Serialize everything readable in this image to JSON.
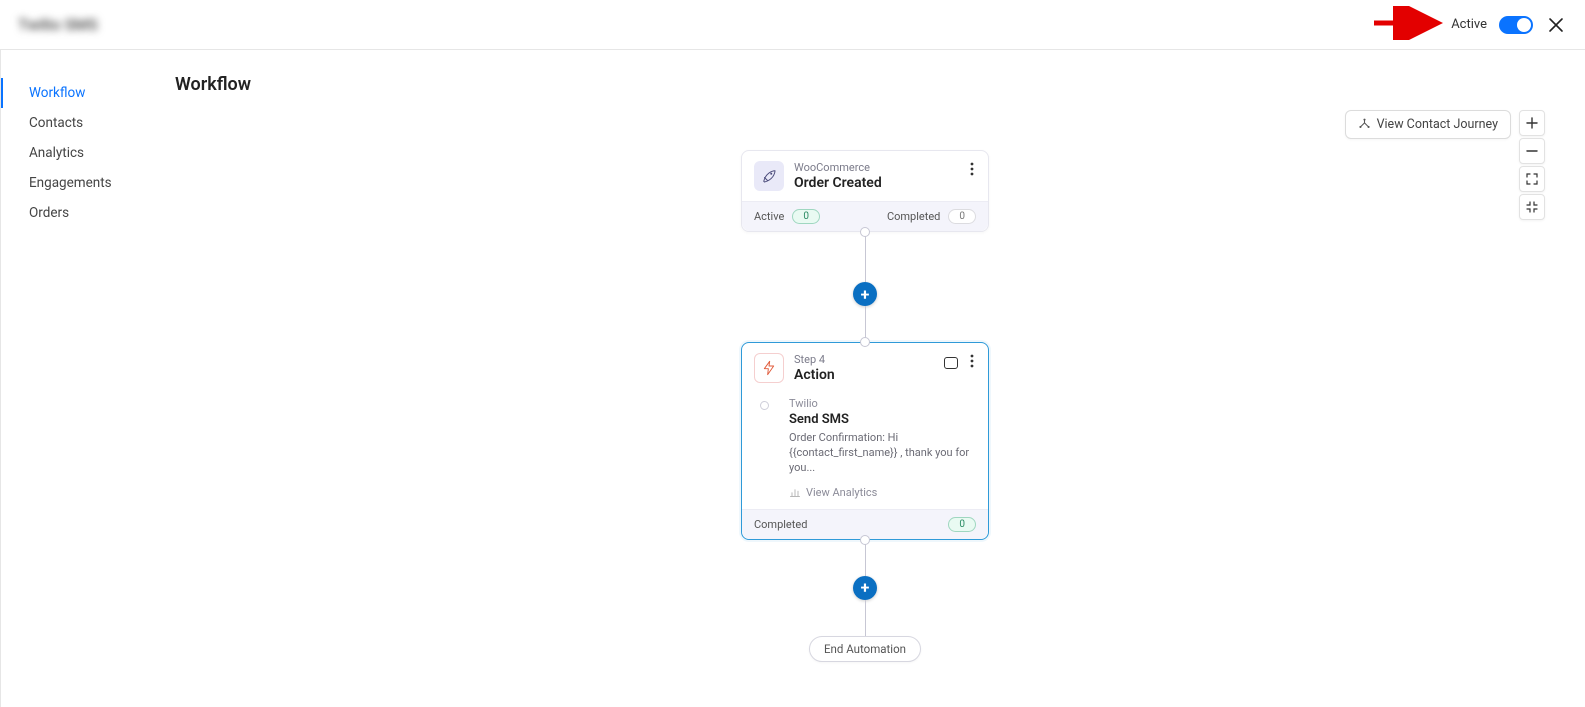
{
  "topbar": {
    "title": "Twilio SMS",
    "active_label": "Active"
  },
  "sidebar": {
    "items": [
      {
        "label": "Workflow",
        "active": true
      },
      {
        "label": "Contacts"
      },
      {
        "label": "Analytics"
      },
      {
        "label": "Engagements"
      },
      {
        "label": "Orders"
      }
    ]
  },
  "page": {
    "title": "Workflow"
  },
  "canvas_controls": {
    "journey_button": "View Contact Journey"
  },
  "flow": {
    "trigger": {
      "source": "WooCommerce",
      "title": "Order Created",
      "stats": {
        "active_label": "Active",
        "active_count": "0",
        "completed_label": "Completed",
        "completed_count": "0"
      }
    },
    "action": {
      "step_label": "Step 4",
      "title": "Action",
      "provider": "Twilio",
      "name": "Send SMS",
      "message": "Order Confirmation: Hi {{contact_first_name}} , thank you for you...",
      "view_analytics": "View Analytics",
      "footer_label": "Completed",
      "footer_count": "0"
    },
    "end_label": "End Automation"
  }
}
